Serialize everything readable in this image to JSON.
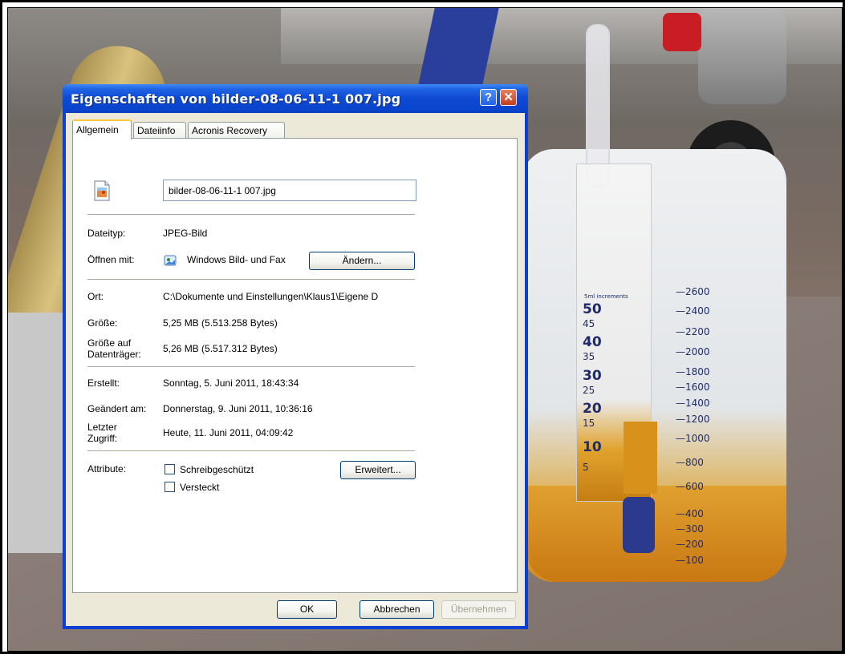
{
  "window": {
    "title": "Eigenschaften von bilder-08-06-11-1 007.jpg",
    "help_glyph": "?",
    "close_glyph": "✕"
  },
  "tabs": [
    {
      "label": "Allgemein",
      "active": true
    },
    {
      "label": "Dateiinfo",
      "active": false
    },
    {
      "label": "Acronis Recovery",
      "active": false
    }
  ],
  "general": {
    "filename": "bilder-08-06-11-1 007.jpg",
    "type_label": "Dateityp:",
    "type_value": "JPEG-Bild",
    "open_with_label": "Öffnen mit:",
    "open_with_value": "Windows Bild- und Fax",
    "change_button": "Ändern...",
    "location_label": "Ort:",
    "location_value": "C:\\Dokumente und Einstellungen\\Klaus1\\Eigene D",
    "size_label": "Größe:",
    "size_value": "5,25 MB (5.513.258 Bytes)",
    "size_on_disk_label_1": "Größe auf",
    "size_on_disk_label_2": "Datenträger:",
    "size_on_disk_value": "5,26 MB (5.517.312 Bytes)",
    "created_label": "Erstellt:",
    "created_value": "Sonntag, 5. Juni 2011, 18:43:34",
    "modified_label": "Geändert am:",
    "modified_value": "Donnerstag, 9. Juni 2011, 10:36:16",
    "accessed_label_1": "Letzter",
    "accessed_label_2": "Zugriff:",
    "accessed_value": "Heute, 11. Juni 2011, 04:09:42",
    "attributes_label": "Attribute:",
    "readonly_label": "Schreibgeschützt",
    "readonly_checked": false,
    "hidden_label": "Versteckt",
    "hidden_checked": false,
    "advanced_button": "Erweitert..."
  },
  "footer": {
    "ok_button": "OK",
    "cancel_button": "Abbrechen",
    "apply_button": "Übernehmen",
    "apply_enabled": false
  },
  "background_photo": {
    "scale_small": [
      "50",
      "45",
      "40",
      "35",
      "30",
      "25",
      "20",
      "15",
      "10",
      "5"
    ],
    "scale_large": [
      "2600",
      "2400",
      "2200",
      "2000",
      "1800",
      "1600",
      "1400",
      "1200",
      "1000",
      "800",
      "600",
      "400",
      "300",
      "200",
      "100"
    ],
    "scale_caption": "5ml increments"
  },
  "colors": {
    "titlebar": "#0a44cd",
    "client": "#ece9d8",
    "tab_highlight": "#ffc83c",
    "close_button": "#c1401e"
  }
}
